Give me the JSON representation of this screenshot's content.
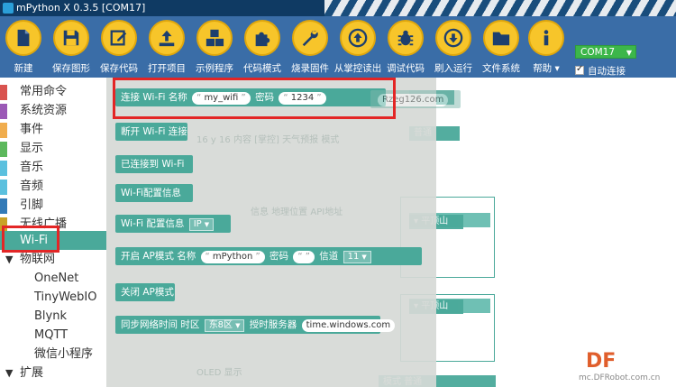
{
  "window": {
    "title": "mPython X 0.3.5 [COM17]"
  },
  "toolbar": {
    "buttons": [
      {
        "label": "新建",
        "icon": "new-file-icon"
      },
      {
        "label": "保存图形",
        "icon": "save-icon"
      },
      {
        "label": "保存代码",
        "icon": "edit-icon"
      },
      {
        "label": "打开项目",
        "icon": "upload-icon"
      },
      {
        "label": "示例程序",
        "icon": "cubes-icon"
      },
      {
        "label": "代码模式",
        "icon": "puzzle-icon"
      },
      {
        "label": "烧录固件",
        "icon": "wrench-icon"
      },
      {
        "label": "从掌控读出",
        "icon": "arrow-up-circle-icon"
      },
      {
        "label": "调试代码",
        "icon": "bug-icon"
      },
      {
        "label": "刷入运行",
        "icon": "arrow-down-circle-icon"
      },
      {
        "label": "文件系统",
        "icon": "folder-icon"
      },
      {
        "label": "帮助",
        "icon": "info-icon"
      }
    ],
    "port": "COM17",
    "auto_connect": "自动连接",
    "accent": "#f7c52a",
    "bar_color": "#3a6da7"
  },
  "sidebar": {
    "categories": [
      {
        "label": "常用命令",
        "color": "#d9534f"
      },
      {
        "label": "系统资源",
        "color": "#9b59b6"
      },
      {
        "label": "事件",
        "color": "#f0ad4e"
      },
      {
        "label": "显示",
        "color": "#5cb85c"
      },
      {
        "label": "音乐",
        "color": "#5bc0de"
      },
      {
        "label": "音频",
        "color": "#5bc0de"
      },
      {
        "label": "引脚",
        "color": "#337ab7"
      },
      {
        "label": "无线广播",
        "color": "#c9a227"
      }
    ],
    "selected": "Wi-Fi",
    "iot_group": "物联网",
    "iot_items": [
      "OneNet",
      "TinyWebIO",
      "Blynk",
      "MQTT",
      "微信小程序"
    ],
    "extend_group": "扩展"
  },
  "flyout": {
    "connect": {
      "label": "连接 Wi-Fi 名称",
      "ssid": "my_wifi",
      "pwd_label": "密码",
      "pwd": "1234"
    },
    "disconnect": "断开 Wi-Fi 连接",
    "connected": "已连接到 Wi-Fi",
    "config_info": "Wi-Fi配置信息",
    "config_info2": {
      "label": "Wi-Fi 配置信息",
      "option": "IP"
    },
    "ap": {
      "label": "开启 AP模式 名称",
      "name": "mPython",
      "pwd_label": "密码",
      "channel_label": "信道",
      "channel": "11"
    },
    "close_ap": "关闭 AP模式",
    "ntp": {
      "label": "同步网络时间 时区",
      "zone": "东8区",
      "server_label": "授时服务器",
      "server": "time.windows.com"
    }
  },
  "workspace": {
    "url_fragment": "Rzeg126.com",
    "content_label": "内容",
    "weather_label": "[掌控] 天气预报",
    "mode_label": "模式",
    "normal": "普通",
    "place": "平顶山",
    "info_label": "信息",
    "place_label": "地理位置",
    "api_label": "API地址",
    "oled_label": "OLED 显示",
    "num16": "16",
    "y_label": "y"
  },
  "logo": {
    "mark": "DF",
    "site": "mc.DFRobot.com.cn"
  }
}
